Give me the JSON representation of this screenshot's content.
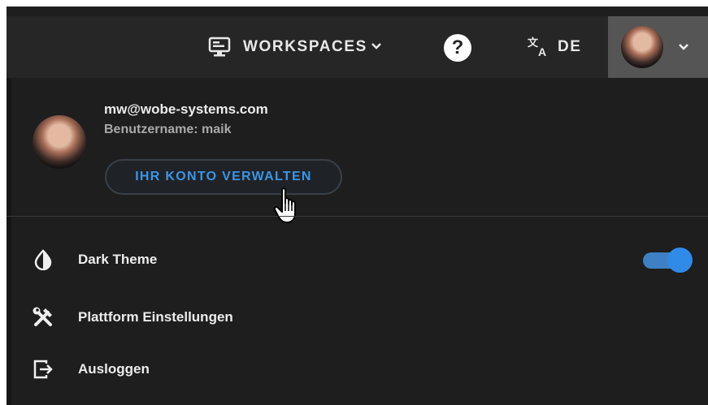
{
  "header": {
    "workspaces_label": "WORKSPACES",
    "help_label": "?",
    "language_code": "DE"
  },
  "profile": {
    "email": "mw@wobe-systems.com",
    "username": "Benutzername: maik",
    "manage_account_label": "IHR KONTO VERWALTEN"
  },
  "menu": {
    "items": [
      {
        "label": "Dark Theme",
        "icon": "contrast-icon",
        "toggle_on": true
      },
      {
        "label": "Plattform Einstellungen",
        "icon": "tools-icon"
      },
      {
        "label": "Ausloggen",
        "icon": "logout-icon"
      }
    ]
  },
  "colors": {
    "background": "#1e1e1e",
    "topbar": "#262626",
    "avatar_button": "#555555",
    "accent": "#2f8ae8",
    "link_text": "#3b95e6"
  }
}
